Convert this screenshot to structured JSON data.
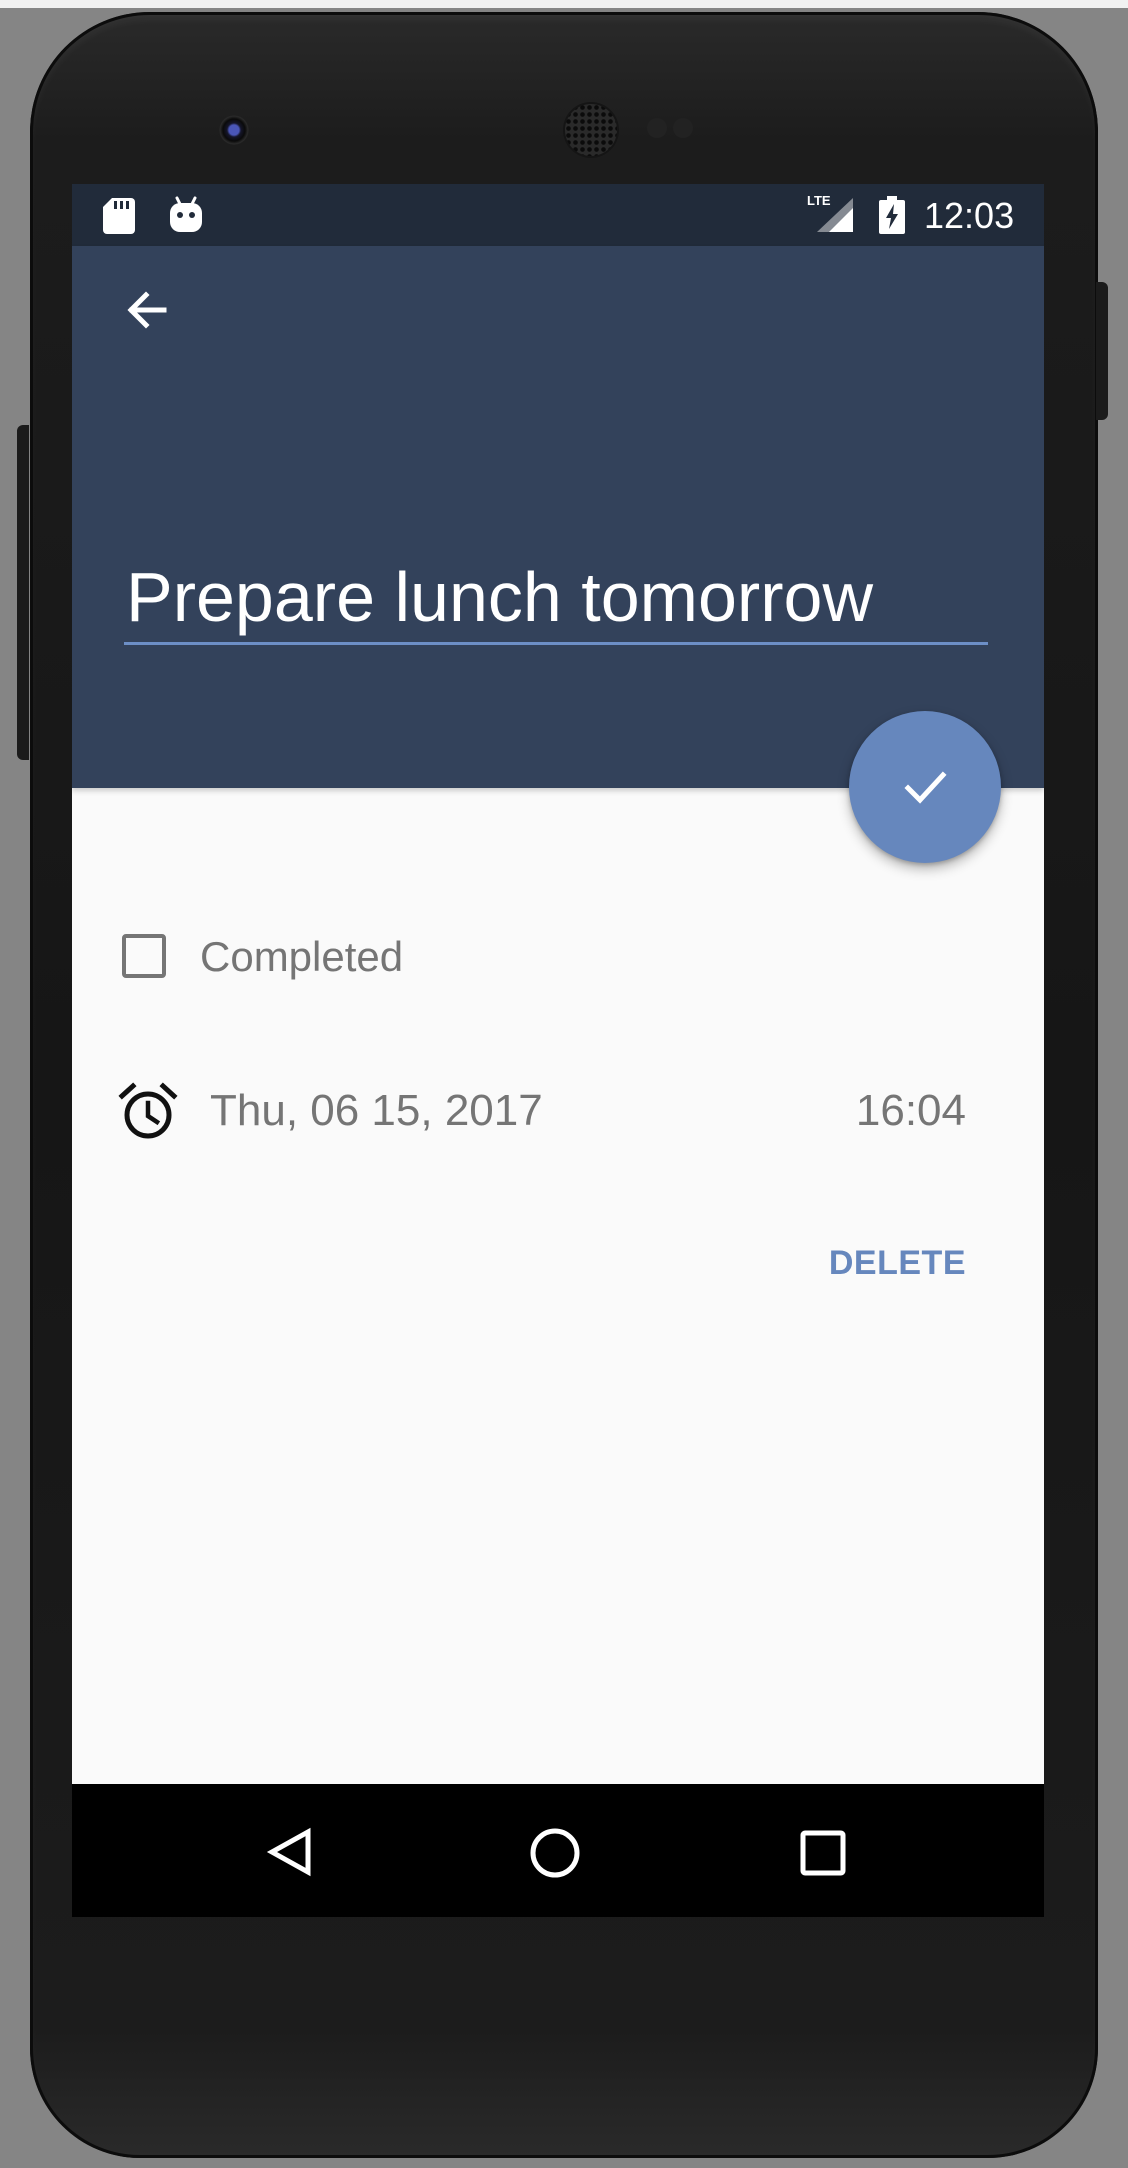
{
  "status_bar": {
    "time": "12:03",
    "network_label": "LTE",
    "icons": [
      "sd-card-icon",
      "android-debug-icon",
      "lte-signal-icon",
      "battery-charging-icon"
    ]
  },
  "task": {
    "title": "Prepare lunch tomorrow",
    "completed_label": "Completed",
    "completed": false,
    "date": "Thu, 06 15, 2017",
    "time": "16:04"
  },
  "actions": {
    "save_icon": "check-icon",
    "back_icon": "arrow-back-icon",
    "delete_label": "DELETE"
  },
  "navigation": [
    "nav-back-icon",
    "nav-home-icon",
    "nav-recents-icon"
  ],
  "colors": {
    "primary": "#33425b",
    "primary_dark": "#212b3a",
    "accent": "#6687bd",
    "background": "#fafafa"
  }
}
